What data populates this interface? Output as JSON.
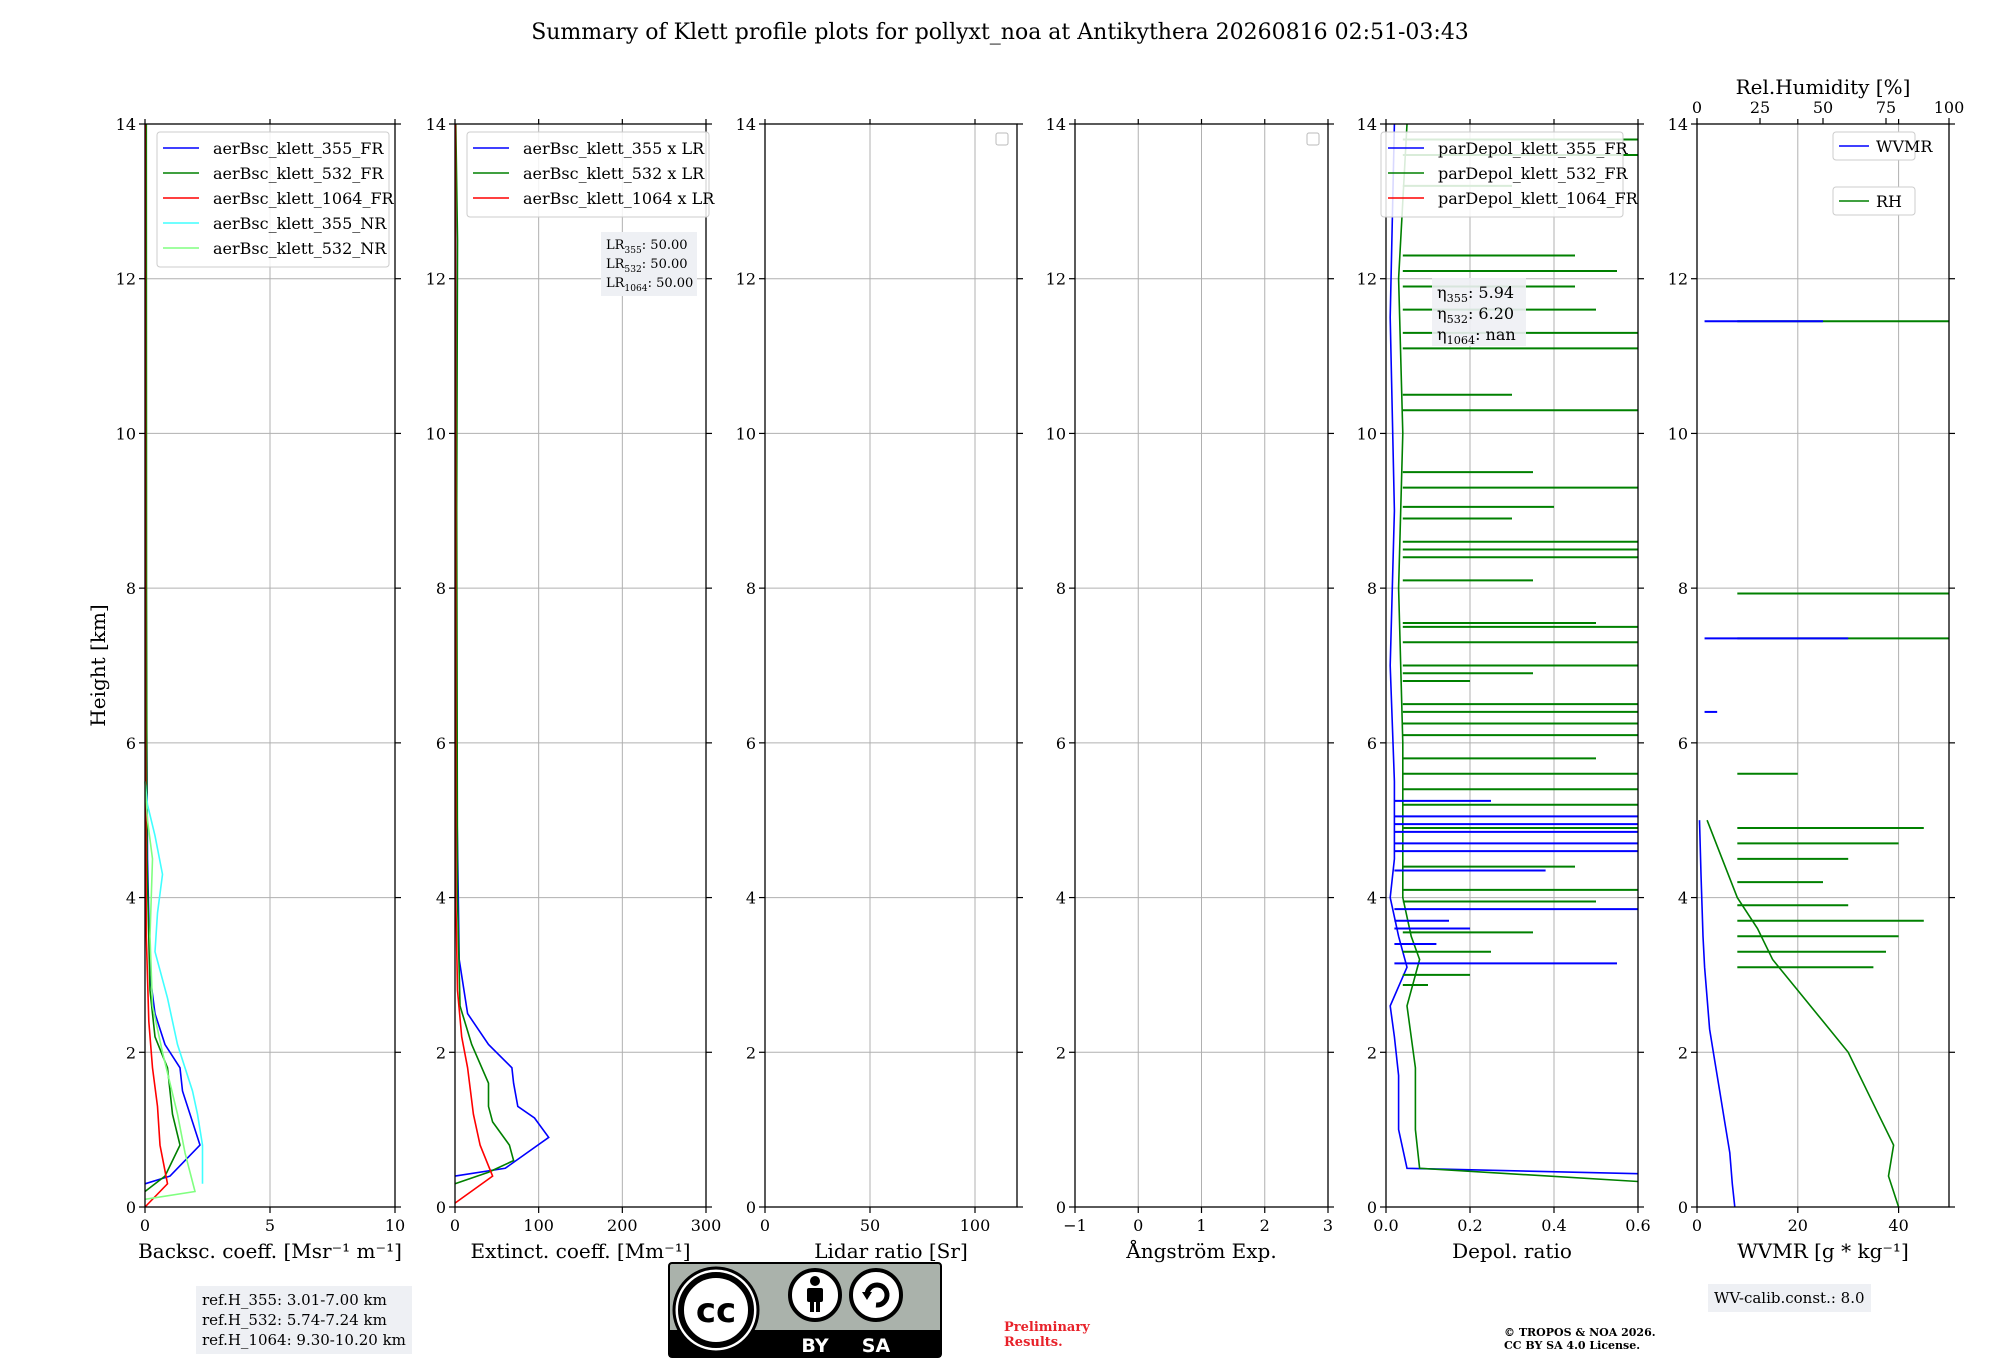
{
  "title": "Summary of Klett profile plots for pollyxt_noa at Antikythera 20260816 02:51-03:43",
  "colors": {
    "blue": "#0000ff",
    "green": "#008000",
    "red": "#ff0000",
    "cyan": "#40ffff",
    "lightgreen": "#80ff80"
  },
  "chart_data": [
    {
      "type": "line",
      "xlabel": "Backsc. coeff. [Msr⁻¹ m⁻¹]",
      "ylabel": "Height [km]",
      "xlim": [
        0,
        10
      ],
      "ylim": [
        0,
        14
      ],
      "xticks": [
        0,
        5,
        10
      ],
      "yticks": [
        0,
        2,
        4,
        6,
        8,
        10,
        12,
        14
      ],
      "grid": true,
      "legend_position": "top-right",
      "series": [
        {
          "name": "aerBsc_klett_355_FR",
          "color": "#0000ff",
          "points": [
            [
              0.0,
              0.3
            ],
            [
              1.0,
              0.4
            ],
            [
              2.2,
              0.8
            ],
            [
              1.9,
              1.1
            ],
            [
              1.5,
              1.5
            ],
            [
              1.4,
              1.8
            ],
            [
              0.8,
              2.1
            ],
            [
              0.4,
              2.5
            ],
            [
              0.2,
              3.0
            ],
            [
              0.1,
              4.5
            ],
            [
              0.05,
              7
            ],
            [
              0.02,
              14
            ]
          ]
        },
        {
          "name": "aerBsc_klett_532_FR",
          "color": "#008000",
          "points": [
            [
              0.0,
              0.2
            ],
            [
              0.8,
              0.4
            ],
            [
              1.4,
              0.8
            ],
            [
              1.1,
              1.2
            ],
            [
              1.0,
              1.5
            ],
            [
              0.9,
              1.8
            ],
            [
              0.4,
              2.2
            ],
            [
              0.2,
              2.8
            ],
            [
              0.08,
              4.5
            ],
            [
              0.06,
              8
            ],
            [
              0.05,
              14
            ]
          ]
        },
        {
          "name": "aerBsc_klett_1064_FR",
          "color": "#ff0000",
          "points": [
            [
              0.0,
              0.0
            ],
            [
              0.9,
              0.3
            ],
            [
              0.6,
              0.8
            ],
            [
              0.5,
              1.3
            ],
            [
              0.3,
              1.8
            ],
            [
              0.15,
              2.4
            ],
            [
              0.05,
              3.5
            ],
            [
              0.02,
              6
            ],
            [
              0.01,
              14
            ]
          ]
        },
        {
          "name": "aerBsc_klett_355_NR",
          "color": "#40ffff",
          "points": [
            [
              2.3,
              0.3
            ],
            [
              2.3,
              0.8
            ],
            [
              2.1,
              1.2
            ],
            [
              1.9,
              1.5
            ],
            [
              1.3,
              2.1
            ],
            [
              0.9,
              2.7
            ],
            [
              0.4,
              3.3
            ],
            [
              0.5,
              3.8
            ],
            [
              0.7,
              4.3
            ],
            [
              0.4,
              4.8
            ],
            [
              0.1,
              5.2
            ],
            [
              0.0,
              5.5
            ]
          ]
        },
        {
          "name": "aerBsc_klett_532_NR",
          "color": "#80ff80",
          "points": [
            [
              0.0,
              0.1
            ],
            [
              2.0,
              0.2
            ],
            [
              1.6,
              0.7
            ],
            [
              1.3,
              1.2
            ],
            [
              1.0,
              1.6
            ],
            [
              0.7,
              2.0
            ],
            [
              0.3,
              2.6
            ],
            [
              0.2,
              3.5
            ],
            [
              0.3,
              4.5
            ],
            [
              0.1,
              5.0
            ],
            [
              0.0,
              5.5
            ]
          ]
        }
      ]
    },
    {
      "type": "line",
      "xlabel": "Extinct. coeff. [Mm⁻¹]",
      "xlim": [
        0,
        300
      ],
      "ylim": [
        0,
        14
      ],
      "xticks": [
        0,
        100,
        200,
        300
      ],
      "yticks": [
        0,
        2,
        4,
        6,
        8,
        10,
        12,
        14
      ],
      "grid": true,
      "legend_position": "top-right",
      "series": [
        {
          "name": "aerBsc_klett_355 x LR",
          "color": "#0000ff",
          "points": [
            [
              0,
              0.4
            ],
            [
              60,
              0.5
            ],
            [
              112,
              0.9
            ],
            [
              95,
              1.15
            ],
            [
              75,
              1.3
            ],
            [
              70,
              1.6
            ],
            [
              68,
              1.8
            ],
            [
              40,
              2.1
            ],
            [
              15,
              2.5
            ],
            [
              5,
              3.2
            ],
            [
              3,
              4.7
            ],
            [
              1,
              6
            ],
            [
              0.5,
              14
            ]
          ]
        },
        {
          "name": "aerBsc_klett_532 x LR",
          "color": "#008000",
          "points": [
            [
              0,
              0.3
            ],
            [
              40,
              0.45
            ],
            [
              70,
              0.6
            ],
            [
              65,
              0.8
            ],
            [
              45,
              1.1
            ],
            [
              40,
              1.3
            ],
            [
              40,
              1.6
            ],
            [
              20,
              2.1
            ],
            [
              6,
              2.6
            ],
            [
              3,
              4
            ],
            [
              2,
              9
            ],
            [
              3,
              12.5
            ],
            [
              1,
              14
            ]
          ]
        },
        {
          "name": "aerBsc_klett_1064 x LR",
          "color": "#ff0000",
          "points": [
            [
              0,
              0.05
            ],
            [
              45,
              0.4
            ],
            [
              30,
              0.8
            ],
            [
              22,
              1.2
            ],
            [
              15,
              1.8
            ],
            [
              8,
              2.2
            ],
            [
              3,
              2.8
            ],
            [
              1,
              4
            ],
            [
              0.5,
              14
            ]
          ]
        }
      ],
      "annotation": [
        "LR355: 50.00",
        "LR532: 50.00",
        "LR1064: 50.00"
      ]
    },
    {
      "type": "line",
      "xlabel": "Lidar ratio [Sr]",
      "xlim": [
        0,
        120
      ],
      "ylim": [
        0,
        14
      ],
      "xticks": [
        0,
        50,
        100
      ],
      "yticks": [
        0,
        2,
        4,
        6,
        8,
        10,
        12,
        14
      ],
      "grid": true,
      "series": []
    },
    {
      "type": "line",
      "xlabel": "Ångström Exp.",
      "xlim": [
        -1,
        3
      ],
      "ylim": [
        0,
        14
      ],
      "xticks": [
        -1,
        0,
        1,
        2,
        3
      ],
      "yticks": [
        0,
        2,
        4,
        6,
        8,
        10,
        12,
        14
      ],
      "grid": true,
      "series": []
    },
    {
      "type": "line",
      "xlabel": "Depol. ratio",
      "xlim": [
        0,
        0.6
      ],
      "ylim": [
        0,
        14
      ],
      "xticks": [
        0.0,
        0.2,
        0.4,
        0.6
      ],
      "tick_labels": [
        "0.0",
        "0.2",
        "0.4",
        "0.6"
      ],
      "yticks": [
        0,
        2,
        4,
        6,
        8,
        10,
        12,
        14
      ],
      "grid": true,
      "legend_position": "top-right",
      "series": [
        {
          "name": "parDepol_klett_355_FR",
          "color": "#0000ff",
          "points": [
            [
              0.6,
              0.43
            ],
            [
              0.05,
              0.5
            ],
            [
              0.03,
              1.0
            ],
            [
              0.03,
              1.7
            ],
            [
              0.02,
              2.2
            ],
            [
              0.01,
              2.6
            ],
            [
              0.05,
              3.1
            ],
            [
              0.03,
              3.5
            ],
            [
              0.01,
              4.0
            ],
            [
              0.02,
              4.5
            ],
            [
              0.02,
              5.5
            ],
            [
              0.01,
              7.0
            ],
            [
              0.02,
              9.0
            ],
            [
              0.01,
              11.5
            ],
            [
              0.02,
              14
            ]
          ]
        },
        {
          "name": "parDepol_klett_532_FR",
          "color": "#008000",
          "points": [
            [
              0.6,
              0.33
            ],
            [
              0.08,
              0.5
            ],
            [
              0.07,
              1.0
            ],
            [
              0.07,
              1.8
            ],
            [
              0.06,
              2.2
            ],
            [
              0.05,
              2.6
            ],
            [
              0.08,
              3.2
            ],
            [
              0.06,
              3.5
            ],
            [
              0.04,
              4.0
            ],
            [
              0.04,
              6.0
            ],
            [
              0.03,
              8.0
            ],
            [
              0.04,
              10.0
            ],
            [
              0.03,
              12.0
            ],
            [
              0.05,
              14
            ]
          ]
        },
        {
          "name": "parDepol_klett_1064_FR",
          "color": "#ff0000",
          "points": []
        }
      ],
      "spikes": {
        "blue": [
          [
            4.85,
            0.6
          ],
          [
            4.7,
            0.6
          ],
          [
            4.95,
            0.6
          ],
          [
            5.05,
            0.6
          ],
          [
            4.6,
            0.6
          ],
          [
            3.15,
            0.55
          ],
          [
            3.85,
            0.6
          ],
          [
            4.35,
            0.38
          ],
          [
            3.6,
            0.2
          ],
          [
            3.4,
            0.12
          ],
          [
            5.25,
            0.25
          ],
          [
            3.7,
            0.15
          ]
        ],
        "green": [
          [
            2.87,
            0.1
          ],
          [
            3.0,
            0.2
          ],
          [
            3.3,
            0.25
          ],
          [
            3.55,
            0.35
          ],
          [
            3.95,
            0.5
          ],
          [
            4.1,
            0.6
          ],
          [
            4.4,
            0.45
          ],
          [
            4.9,
            0.6
          ],
          [
            5.2,
            0.6
          ],
          [
            5.4,
            0.6
          ],
          [
            5.6,
            0.6
          ],
          [
            5.8,
            0.5
          ],
          [
            6.1,
            0.6
          ],
          [
            6.25,
            0.6
          ],
          [
            6.4,
            0.6
          ],
          [
            6.5,
            0.6
          ],
          [
            6.8,
            0.2
          ],
          [
            6.9,
            0.35
          ],
          [
            7.0,
            0.6
          ],
          [
            7.3,
            0.6
          ],
          [
            7.5,
            0.6
          ],
          [
            7.55,
            0.5
          ],
          [
            8.1,
            0.35
          ],
          [
            8.4,
            0.6
          ],
          [
            8.5,
            0.6
          ],
          [
            8.6,
            0.6
          ],
          [
            8.9,
            0.3
          ],
          [
            9.05,
            0.4
          ],
          [
            9.3,
            0.6
          ],
          [
            9.5,
            0.35
          ],
          [
            10.3,
            0.6
          ],
          [
            10.5,
            0.3
          ],
          [
            11.1,
            0.6
          ],
          [
            11.3,
            0.6
          ],
          [
            11.6,
            0.5
          ],
          [
            11.9,
            0.45
          ],
          [
            12.1,
            0.55
          ],
          [
            12.3,
            0.45
          ],
          [
            13.2,
            0.3
          ],
          [
            13.6,
            0.6
          ],
          [
            13.8,
            0.6
          ]
        ]
      },
      "annotation": [
        "η355: 5.94",
        "η532: 6.20",
        "η1064: nan"
      ]
    },
    {
      "type": "line",
      "xlabel": "WVMR [g * kg⁻¹]",
      "x2label": "Rel.Humidity [%]",
      "xlim": [
        0,
        50
      ],
      "x2lim": [
        0,
        100
      ],
      "ylim": [
        0,
        14
      ],
      "xticks": [
        0,
        20,
        40
      ],
      "x2ticks": [
        0,
        25,
        50,
        75,
        100
      ],
      "yticks": [
        0,
        2,
        4,
        6,
        8,
        10,
        12,
        14
      ],
      "grid": true,
      "legend_position": "top-right",
      "series": [
        {
          "name": "WVMR",
          "color": "#0000ff",
          "points": [
            [
              7.5,
              0.0
            ],
            [
              7.0,
              0.3
            ],
            [
              6.5,
              0.7
            ],
            [
              5.5,
              1.1
            ],
            [
              4.5,
              1.5
            ],
            [
              3.5,
              1.9
            ],
            [
              2.5,
              2.3
            ],
            [
              2.0,
              2.7
            ],
            [
              1.5,
              3.1
            ],
            [
              1.2,
              3.5
            ],
            [
              1.0,
              3.9
            ],
            [
              0.8,
              4.3
            ],
            [
              0.5,
              5.0
            ]
          ]
        },
        {
          "name": "RH",
          "color": "#008000",
          "points": [
            [
              40,
              0.0
            ],
            [
              38,
              0.4
            ],
            [
              39,
              0.8
            ],
            [
              36,
              1.2
            ],
            [
              33,
              1.6
            ],
            [
              30,
              2.0
            ],
            [
              25,
              2.4
            ],
            [
              20,
              2.8
            ],
            [
              15,
              3.2
            ],
            [
              12,
              3.6
            ],
            [
              8,
              4.0
            ],
            [
              5,
              4.5
            ],
            [
              2,
              5.0
            ]
          ]
        }
      ],
      "spikes": {
        "green": [
          [
            3.1,
            0.7
          ],
          [
            3.3,
            0.75
          ],
          [
            3.5,
            0.8
          ],
          [
            3.7,
            0.9
          ],
          [
            3.9,
            0.6
          ],
          [
            4.2,
            0.5
          ],
          [
            4.5,
            0.6
          ],
          [
            4.7,
            0.8
          ],
          [
            4.9,
            0.9
          ],
          [
            5.6,
            0.4
          ],
          [
            7.35,
            1.0
          ],
          [
            7.93,
            1.0
          ],
          [
            11.45,
            1.0
          ]
        ],
        "blue": [
          [
            7.35,
            0.6
          ],
          [
            11.45,
            0.5
          ],
          [
            6.4,
            0.08
          ],
          [
            5.6,
            0.03
          ]
        ]
      },
      "annotation": [
        "WV-calib.const.: 8.0"
      ]
    }
  ],
  "ref_heights": [
    "ref.H_355: 3.01-7.00 km",
    "ref.H_532: 5.74-7.24 km",
    "ref.H_1064: 9.30-10.20 km"
  ],
  "wv_calib": "WV-calib.const.: 8.0",
  "lr_lines": [
    {
      "base": "LR",
      "sub": "355",
      "val": ": 50.00"
    },
    {
      "base": "LR",
      "sub": "532",
      "val": ": 50.00"
    },
    {
      "base": "LR",
      "sub": "1064",
      "val": ": 50.00"
    }
  ],
  "eta_lines": [
    {
      "base": "η",
      "sub": "355",
      "val": ": 5.94"
    },
    {
      "base": "η",
      "sub": "532",
      "val": ": 6.20"
    },
    {
      "base": "η",
      "sub": "1064",
      "val": ": nan"
    }
  ],
  "license_badge": {
    "cc": "cc",
    "by": "BY",
    "sa": "SA"
  },
  "preliminary": [
    "Preliminary",
    "Results."
  ],
  "copyright": [
    "© TROPOS & NOA 2026.",
    "CC BY SA 4.0 License."
  ]
}
